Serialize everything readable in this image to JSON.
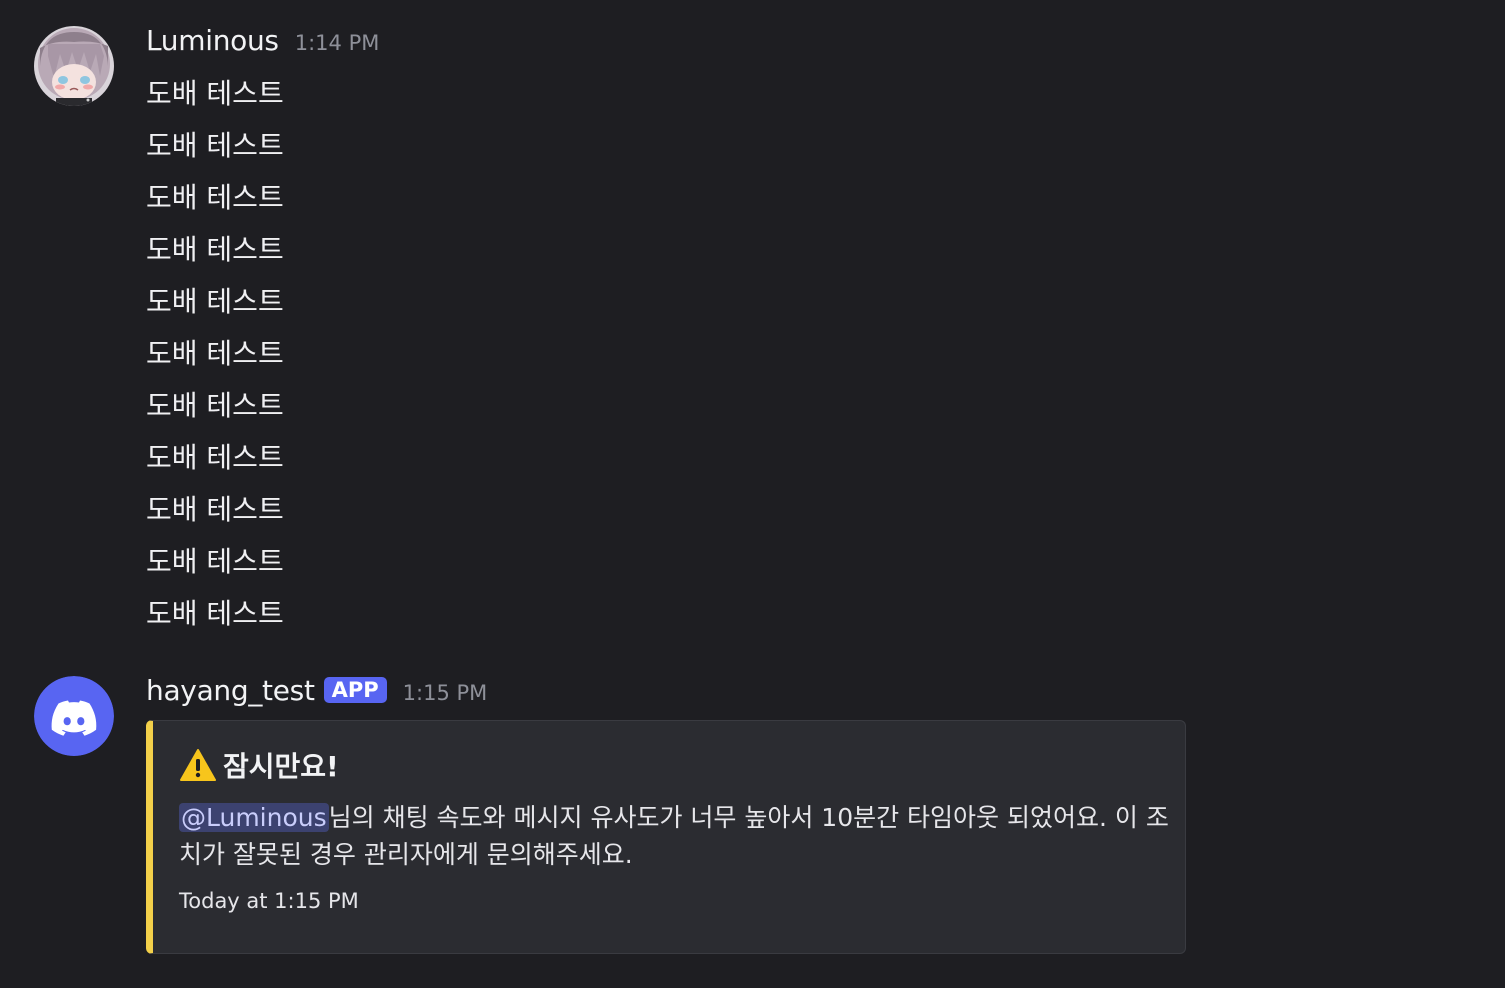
{
  "messages": [
    {
      "author": "Luminous",
      "time": "1:14 PM",
      "avatar_icon": "anime-girl-avatar",
      "lines": [
        "도배 테스트",
        "도배 테스트",
        "도배 테스트",
        "도배 테스트",
        "도배 테스트",
        "도배 테스트",
        "도배 테스트",
        "도배 테스트",
        "도배 테스트",
        "도배 테스트",
        "도배 테스트"
      ]
    },
    {
      "author": "hayang_test",
      "badge": "APP",
      "time": "1:15 PM",
      "avatar_icon": "discord-logo-icon",
      "embed": {
        "accent_color": "#f3d04a",
        "title": "잠시만요!",
        "title_icon": "warning-icon",
        "mention": "@Luminous",
        "description": "님의 채팅 속도와 메시지 유사도가 너무 높아서 10분간 타임아웃 되었어요. 이 조치가 잘못된 경우 관리자에게 문의해주세요.",
        "footer": "Today at 1:15 PM"
      }
    }
  ],
  "colors": {
    "background": "#1e1e22",
    "app_badge": "#5865f2",
    "discord_blurple": "#5865f2",
    "embed_accent": "#f3d04a"
  }
}
